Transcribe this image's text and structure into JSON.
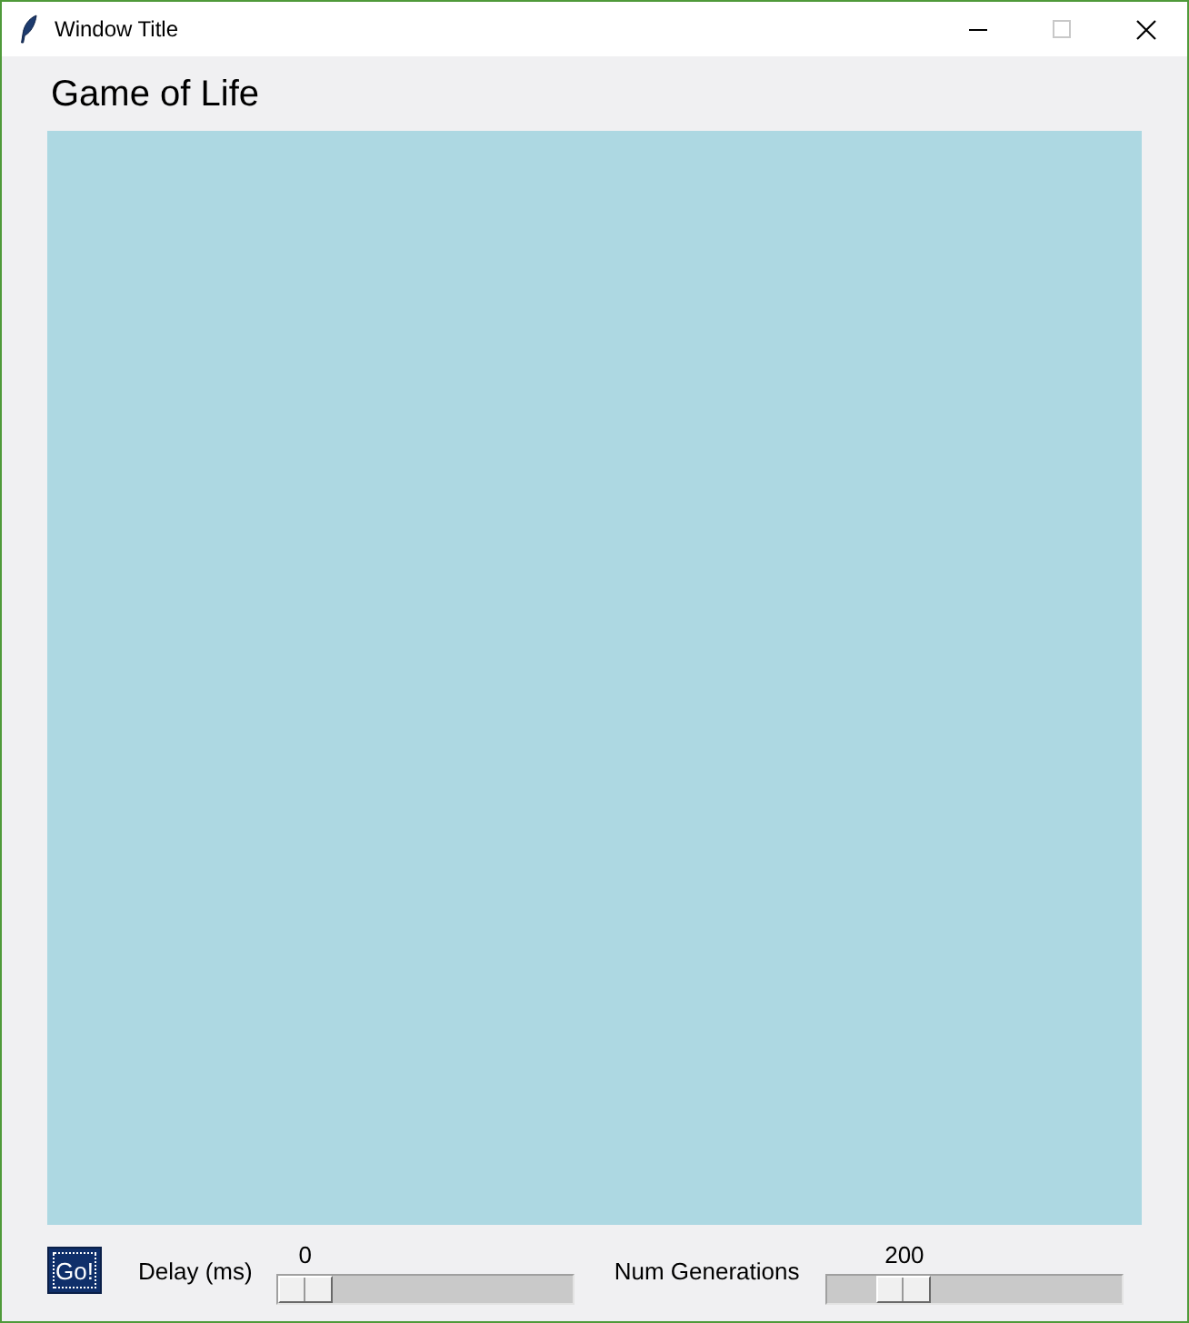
{
  "window": {
    "title": "Window Title",
    "controls": [
      {
        "kind": "minimize",
        "disabled": false
      },
      {
        "kind": "maximize",
        "disabled": true
      },
      {
        "kind": "close",
        "disabled": false
      }
    ]
  },
  "heading": "Game of Life",
  "go_button": {
    "label": "Go!",
    "focused": true
  },
  "sliders": [
    {
      "label": "Delay (ms)",
      "reading": "0",
      "level": 0
    },
    {
      "label": "Num Generations",
      "reading": "200",
      "level": 0.21
    }
  ]
}
